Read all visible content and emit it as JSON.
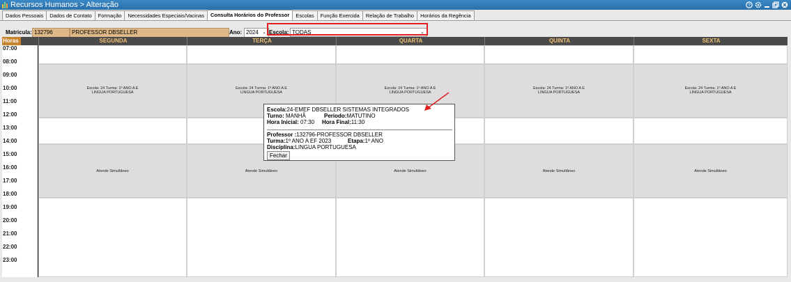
{
  "window": {
    "title": "Recursos Humanos > Alteração"
  },
  "tabs": [
    {
      "label": "Dados Pessoais",
      "active": false
    },
    {
      "label": "Dados de Contato",
      "active": false
    },
    {
      "label": "Formação",
      "active": false
    },
    {
      "label": "Necessidades Especiais/Vacinas",
      "active": false
    },
    {
      "label": "Consulta Horários do Professor",
      "active": true
    },
    {
      "label": "Escolas",
      "active": false
    },
    {
      "label": "Função Exercida",
      "active": false
    },
    {
      "label": "Relação de Trabalho",
      "active": false
    },
    {
      "label": "Horários da Regência",
      "active": false
    }
  ],
  "filters": {
    "matricula_label": "Matricula:",
    "matricula_value": "132796",
    "name_value": "PROFESSOR DBSELLER",
    "ano_label": "Ano:",
    "ano_value": "2024",
    "escola_label": "Escola:",
    "escola_value": "TODAS"
  },
  "schedule": {
    "horas_header": "Horas",
    "days": [
      "SEGUNDA",
      "TERÇA",
      "QUARTA",
      "QUINTA",
      "SEXTA"
    ],
    "hours": [
      "07:00",
      "08:00",
      "09:00",
      "10:00",
      "11:00",
      "12:00",
      "13:00",
      "14:00",
      "15:00",
      "16:00",
      "17:00",
      "18:00",
      "19:00",
      "20:00",
      "21:00",
      "22:00",
      "23:00"
    ],
    "morning_block": {
      "line1": "Escola: 24 Turma: 1º ANO A E",
      "line2": "LINGUA PORTUGUESA"
    },
    "afternoon_block": {
      "text": "Atende Simultâneo"
    }
  },
  "popup": {
    "escola_label": "Escola:",
    "escola_value": "24-EMEF DBSELLER SISTEMAS INTEGRADOS",
    "turno_label": "Turno:",
    "turno_value": " MANHÃ",
    "periodo_label": "Periodo:",
    "periodo_value": "MATUTINO",
    "hora_inicial_label": "Hora Inicial:",
    "hora_inicial_value": " 07:30",
    "hora_final_label": "Hora Final:",
    "hora_final_value": "11:30",
    "professor_label": "Professor :",
    "professor_value": "132796-PROFESSOR DBSELLER",
    "turma_label": "Turma:",
    "turma_value": "1º ANO A EF 2023",
    "etapa_label": "Etapa:",
    "etapa_value": "1º ANO",
    "disciplina_label": "Disciplina:",
    "disciplina_value": "LINGUA PORTUGUESA",
    "close_label": "Fechar"
  },
  "colors": {
    "titlebar": "#2a6fa8",
    "header_bg": "#4a4a4a",
    "header_text": "#f0c070",
    "horas_bg": "#c8842c",
    "input_tan": "#deb887",
    "highlight_red": "#e02020",
    "block_gray": "#dedcdc"
  }
}
